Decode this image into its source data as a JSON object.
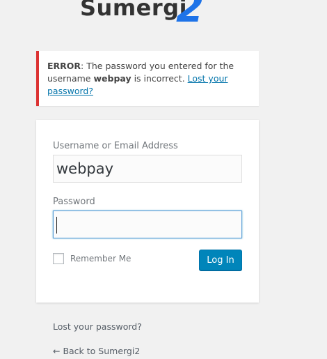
{
  "logo": {
    "text": "Sumergi",
    "accent": "2"
  },
  "error": {
    "prefix": "ERROR",
    "message_1": ": The password you entered for the username ",
    "username": "webpay",
    "message_2": " is incorrect. ",
    "link": "Lost your password?"
  },
  "form": {
    "username_label": "Username or Email Address",
    "username_value": "webpay",
    "password_label": "Password",
    "password_value": "",
    "remember_label": "Remember Me",
    "submit_label": "Log In"
  },
  "footer": {
    "lost_password": "Lost your password?",
    "back_link": "← Back to Sumergi2"
  },
  "colors": {
    "error_border": "#dc3232",
    "link": "#0073aa",
    "primary_button": "#0085ba",
    "logo_accent": "#1e73e8"
  }
}
